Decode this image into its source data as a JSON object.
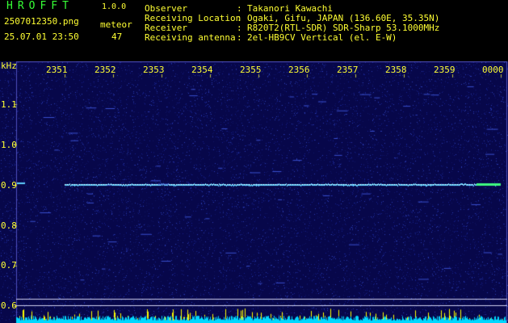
{
  "header": {
    "app_title": "HROFFT",
    "app_version": "1.0.0",
    "file_name": "2507012350.png",
    "meteor_label": "meteor",
    "timestamp": "25.07.01 23:50",
    "meteor_count": "47",
    "info": [
      {
        "label": "Observer",
        "value": "Takanori Kawachi"
      },
      {
        "label": "Receiving Location",
        "value": "Ogaki, Gifu, JAPAN (136.60E, 35.35N)"
      },
      {
        "label": "Receiver",
        "value": "R820T2(RTL-SDR) SDR-Sharp 53.1000MHz"
      },
      {
        "label": "Receiving antenna",
        "value": "2el-HB9CV Vertical (el. E-W)"
      }
    ],
    "separator": ":"
  },
  "spectrogram": {
    "unit_label": "kHz",
    "time_ticks": [
      "2351",
      "2352",
      "2353",
      "2354",
      "2355",
      "2356",
      "2357",
      "2358",
      "2359",
      "0000"
    ],
    "freq_ticks": [
      "1.1",
      "1.0",
      "0.9",
      "0.8",
      "0.7",
      "0.6"
    ],
    "colors": {
      "background": "#07074a",
      "noise": "#2a3cb0",
      "carrier": "#5fd0ff",
      "axis_text": "#ffff33",
      "level_bar": "#00d8ff",
      "level_peak": "#ffff00"
    }
  }
}
